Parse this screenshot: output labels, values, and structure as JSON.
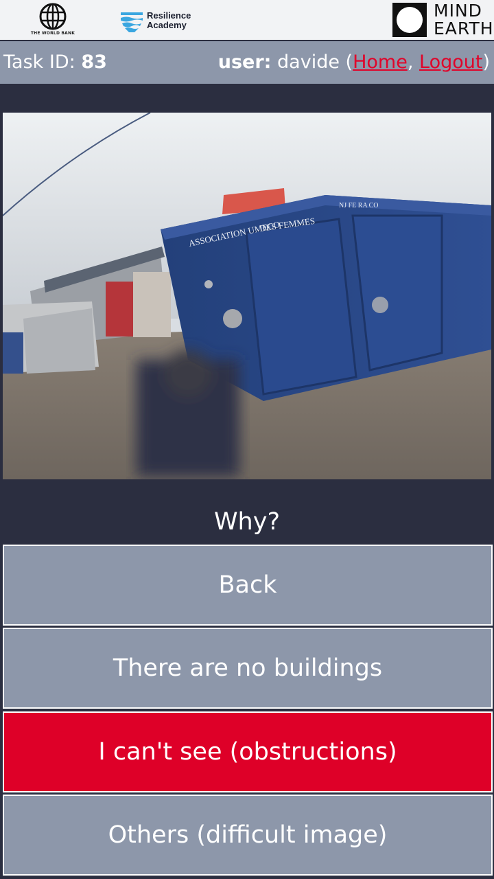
{
  "header": {
    "world_bank_label": "THE WORLD BANK",
    "resilience_line1": "Resilience",
    "resilience_line2": "Academy",
    "mindearth_line1": "MIND",
    "mindearth_line2": "EARTH"
  },
  "task_bar": {
    "task_label": "Task ID:",
    "task_id": "83",
    "user_label": "user:",
    "username": "davide",
    "home_link": "Home",
    "logout_link": "Logout"
  },
  "photo": {
    "sign_text_1": "ASSOCIATION UMECO",
    "sign_text_2": "DES FEMMES",
    "sign_text_3": "NJ FE RA CO"
  },
  "question": "Why?",
  "options": [
    {
      "label": "Back",
      "color": "#8d97aa"
    },
    {
      "label": "There are no buildings",
      "color": "#8d97aa"
    },
    {
      "label": "I can't see (obstructions)",
      "color": "#de0028"
    },
    {
      "label": "Others (difficult image)",
      "color": "#8d97aa"
    }
  ]
}
